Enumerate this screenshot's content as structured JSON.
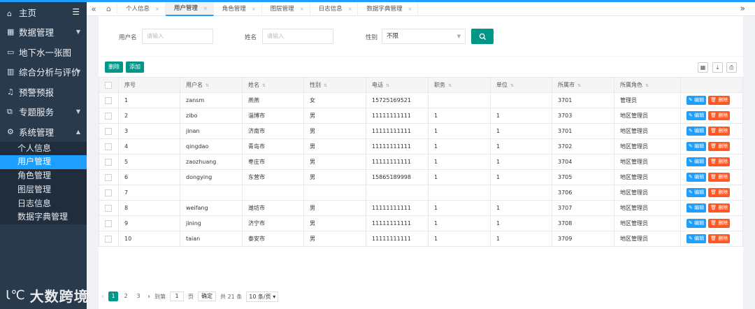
{
  "sidebar": {
    "home": "主页",
    "items": [
      {
        "label": "数据管理",
        "icon": "grid-icon",
        "arrow": "▼"
      },
      {
        "label": "地下水一张图",
        "icon": "monitor-icon",
        "arrow": ""
      },
      {
        "label": "综合分析与评价",
        "icon": "bars-icon",
        "arrow": "▼"
      },
      {
        "label": "预警预报",
        "icon": "bell-icon",
        "arrow": ""
      },
      {
        "label": "专题服务",
        "icon": "share-icon",
        "arrow": "▼"
      },
      {
        "label": "系统管理",
        "icon": "gear-icon",
        "arrow": "▲"
      }
    ],
    "subitems": [
      "个人信息",
      "用户管理",
      "角色管理",
      "图层管理",
      "日志信息",
      "数据字典管理"
    ]
  },
  "tabs": [
    "个人信息",
    "用户管理",
    "角色管理",
    "图层管理",
    "日志信息",
    "数据字典管理"
  ],
  "search": {
    "username_label": "用户名",
    "username_placeholder": "请输入",
    "name_label": "姓名",
    "name_placeholder": "请输入",
    "gender_label": "性别",
    "gender_value": "不限"
  },
  "toolbar": {
    "delete": "删除",
    "add": "添加"
  },
  "table": {
    "headers": [
      "序号",
      "用户名",
      "姓名",
      "性别",
      "电话",
      "职务",
      "单位",
      "所属市",
      "所属角色"
    ],
    "edit_label": "编辑",
    "delete_label": "删除",
    "rows": [
      [
        "1",
        "zansm",
        "燕燕",
        "女",
        "15725169521",
        "",
        "",
        "3701",
        "管理员"
      ],
      [
        "2",
        "zibo",
        "淄博市",
        "男",
        "11111111111",
        "1",
        "1",
        "3703",
        "地区管理员"
      ],
      [
        "3",
        "jinan",
        "济南市",
        "男",
        "11111111111",
        "1",
        "1",
        "3701",
        "地区管理员"
      ],
      [
        "4",
        "qingdao",
        "青岛市",
        "男",
        "11111111111",
        "1",
        "1",
        "3702",
        "地区管理员"
      ],
      [
        "5",
        "zaozhuang",
        "枣庄市",
        "男",
        "11111111111",
        "1",
        "1",
        "3704",
        "地区管理员"
      ],
      [
        "6",
        "dongying",
        "东营市",
        "男",
        "15865189998",
        "1",
        "1",
        "3705",
        "地区管理员"
      ],
      [
        "7",
        "",
        "",
        "",
        "",
        "",
        "",
        "3706",
        "地区管理员"
      ],
      [
        "8",
        "weifang",
        "潍坊市",
        "男",
        "11111111111",
        "1",
        "1",
        "3707",
        "地区管理员"
      ],
      [
        "9",
        "jining",
        "济宁市",
        "男",
        "11111111111",
        "1",
        "1",
        "3708",
        "地区管理员"
      ],
      [
        "10",
        "taian",
        "泰安市",
        "男",
        "11111111111",
        "1",
        "1",
        "3709",
        "地区管理员"
      ]
    ]
  },
  "pager": {
    "pages": [
      "1",
      "2",
      "3"
    ],
    "current": "1",
    "goto_label": "到第",
    "goto_value": "1",
    "page_unit": "页",
    "confirm": "确定",
    "total": "共 21 条",
    "page_size": "10 条/页"
  },
  "watermark": {
    "logo": "Ɩ℃",
    "text": "大数跨境"
  }
}
